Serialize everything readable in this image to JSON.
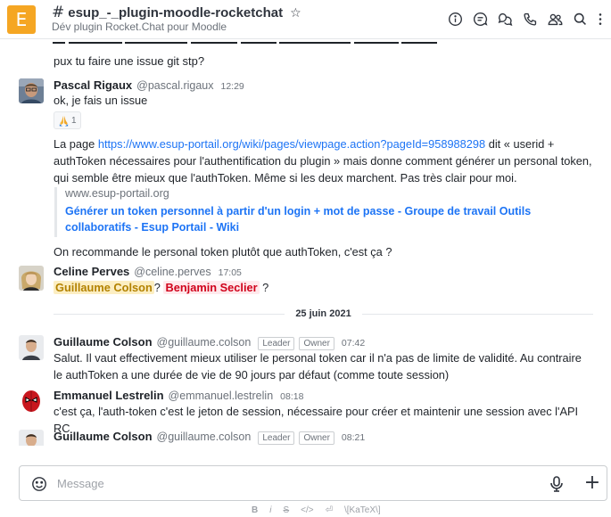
{
  "header": {
    "room_initial": "E",
    "room_name": "esup_-_plugin-moodle-rocketchat",
    "topic": "Dév plugin Rocket.Chat pour Moodle",
    "icons": [
      "info-icon",
      "threads-icon",
      "discussion-icon",
      "call-icon",
      "members-icon",
      "search-icon",
      "kebab-icon"
    ]
  },
  "messages": {
    "top_line": "pux tu faire une issue git stp?",
    "pascal": {
      "author": "Pascal Rigaux",
      "handle": "@pascal.rigaux",
      "time": "12:29",
      "text": "ok, je fais un issue",
      "reaction_count": "1",
      "para_prefix": "La page ",
      "para_link": "https://www.esup-portail.org/wiki/pages/viewpage.action?pageId=958988298",
      "para_suffix": " dit « userid + authToken nécessaires pour l'authentification du plugin » mais donne comment générer un personal token, qui semble être mieux que l'authToken. Même si les deux marchent. Pas très clair pour moi.",
      "preview_host": "www.esup-portail.org",
      "preview_title": "Générer un token personnel à partir d'un login + mot de passe - Groupe de travail Outils collaboratifs - Esup Portail - Wiki",
      "followup": "On recommande le personal token plutôt que authToken, c'est ça ?"
    },
    "celine": {
      "author": "Celine Perves",
      "handle": "@celine.perves",
      "time": "17:05",
      "mention1": "Guillaume Colson",
      "sep1": "? ",
      "mention2": "Benjamin Seclier",
      "sep2": " ?"
    },
    "day_divider": "25 juin 2021",
    "guillaume1": {
      "author": "Guillaume Colson",
      "handle": "@guillaume.colson",
      "role1": "Leader",
      "role2": "Owner",
      "time": "07:42",
      "text": "Salut. Il vaut effectivement mieux utiliser le personal token car il n'a pas de limite de validité. Au contraire le authToken a une durée de vie de 90 jours par défaut (comme toute session)"
    },
    "emmanuel": {
      "author": "Emmanuel Lestrelin",
      "handle": "@emmanuel.lestrelin",
      "time": "08:18",
      "text": "c'est ça, l'auth-token c'est le jeton de session, nécessaire pour créer et maintenir une session avec l'API RC"
    },
    "guillaume2": {
      "author": "Guillaume Colson",
      "handle": "@guillaume.colson",
      "role1": "Leader",
      "role2": "Owner",
      "time": "08:21"
    }
  },
  "composer": {
    "placeholder": "Message",
    "format_buttons": [
      "B",
      "i",
      "S",
      "</>",
      "⏎",
      "\\[KaTeX\\]"
    ]
  },
  "colors": {
    "link": "#1d74f5",
    "room_avatar": "#f5a623",
    "mention_self": "#fceec2",
    "mention_other": "#ffe9ec"
  }
}
